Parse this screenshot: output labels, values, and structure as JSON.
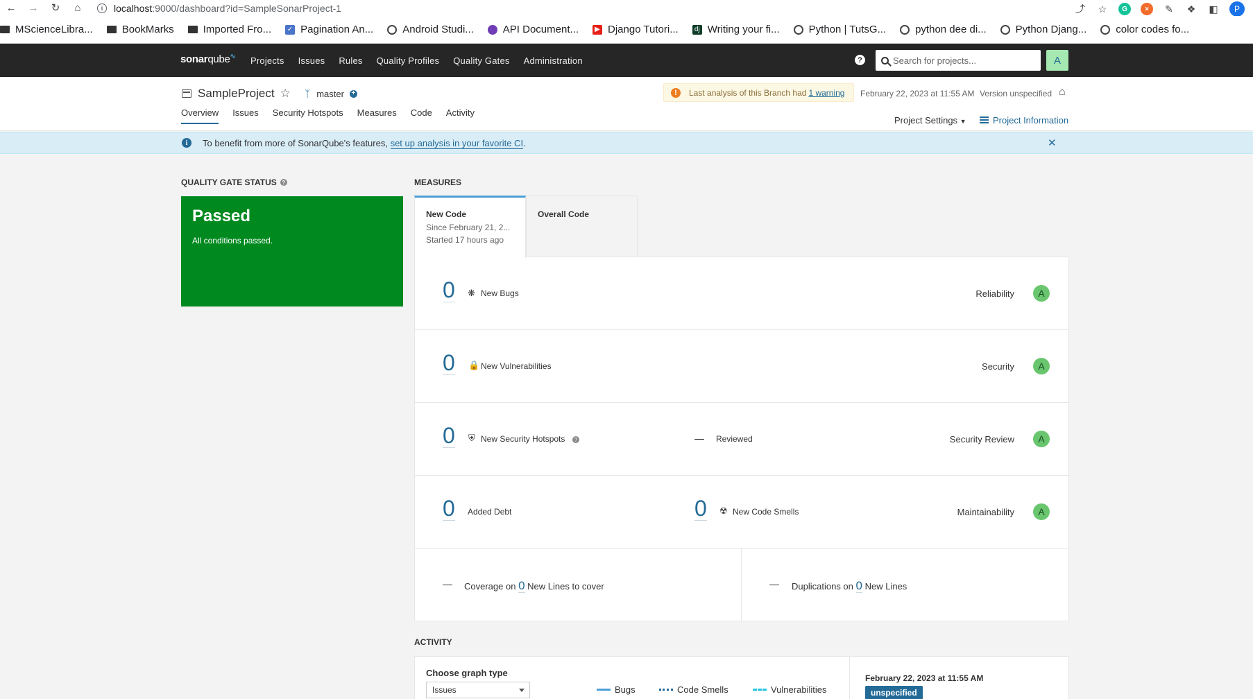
{
  "browser": {
    "url_host": "localhost",
    "url_path": ":9000/dashboard?id=SampleSonarProject-1",
    "bookmarks": [
      {
        "label": "MScienceLibra...",
        "icon": "folder-icon"
      },
      {
        "label": "BookMarks",
        "icon": "folder-icon"
      },
      {
        "label": "Imported Fro...",
        "icon": "folder-icon"
      },
      {
        "label": "Pagination An...",
        "icon": "page-icon"
      },
      {
        "label": "Android Studi...",
        "icon": "globe-icon"
      },
      {
        "label": "API Document...",
        "icon": "purple-dot-icon"
      },
      {
        "label": "Django Tutori...",
        "icon": "youtube-icon"
      },
      {
        "label": "Writing your fi...",
        "icon": "dj-icon"
      },
      {
        "label": "Python | TutsG...",
        "icon": "globe-icon"
      },
      {
        "label": "python dee di...",
        "icon": "globe-icon"
      },
      {
        "label": "Python Djang...",
        "icon": "gear-globe-icon"
      },
      {
        "label": "color codes fo...",
        "icon": "globe-icon"
      }
    ],
    "profile_initial": "P"
  },
  "nav": {
    "logo_prefix": "sonar",
    "logo_suffix": "qube",
    "links": [
      "Projects",
      "Issues",
      "Rules",
      "Quality Profiles",
      "Quality Gates",
      "Administration"
    ],
    "search_placeholder": "Search for projects...",
    "user_initial": "A"
  },
  "project": {
    "name": "SampleProject",
    "branch": "master",
    "warning_text": "Last analysis of this Branch had",
    "warning_link": "1 warning",
    "analysis_date": "February 22, 2023 at 11:55 AM",
    "version": "Version unspecified",
    "tabs": [
      "Overview",
      "Issues",
      "Security Hotspots",
      "Measures",
      "Code",
      "Activity"
    ],
    "settings_label": "Project Settings",
    "info_label": "Project Information"
  },
  "banner": {
    "text": "To benefit from more of SonarQube's features,",
    "link": "set up analysis in your favorite CI",
    "suffix": "."
  },
  "quality_gate": {
    "title": "QUALITY GATE STATUS",
    "status": "Passed",
    "subtitle": "All conditions passed.",
    "color": "#00891f"
  },
  "measures": {
    "title": "MEASURES",
    "new_code_tab": {
      "title": "New Code",
      "line1": "Since February 21, 2...",
      "line2": "Started 17 hours ago"
    },
    "overall_tab": {
      "title": "Overall Code"
    },
    "bugs": {
      "value": "0",
      "label": "New Bugs",
      "category": "Reliability",
      "rating": "A"
    },
    "vulnerabilities": {
      "value": "0",
      "label": "New Vulnerabilities",
      "category": "Security",
      "rating": "A"
    },
    "hotspots": {
      "value": "0",
      "label": "New Security Hotspots",
      "reviewed_label": "Reviewed",
      "category": "Security Review",
      "rating": "A"
    },
    "debt": {
      "value": "0",
      "label": "Added Debt",
      "smells_value": "0",
      "smells_label": "New Code Smells",
      "category": "Maintainability",
      "rating": "A"
    },
    "coverage": {
      "prefix": "Coverage on",
      "value": "0",
      "suffix": "New Lines to cover"
    },
    "duplications": {
      "prefix": "Duplications on",
      "value": "0",
      "suffix": "New Lines"
    }
  },
  "activity": {
    "title": "ACTIVITY",
    "graph_label": "Choose graph type",
    "graph_value": "Issues",
    "legend": [
      "Bugs",
      "Code Smells",
      "Vulnerabilities"
    ],
    "date": "February 22, 2023 at 11:55 AM",
    "badge": "unspecified"
  }
}
